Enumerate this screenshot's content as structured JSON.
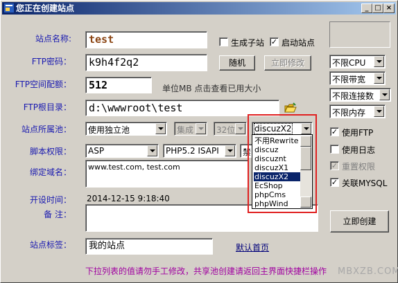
{
  "window": {
    "title": "您正在创建站点",
    "minimize": "_",
    "maximize": "□",
    "close": "×"
  },
  "labels": {
    "site_name": "站点名称:",
    "ftp_password": "FTP密码：",
    "ftp_quota": "FTP空间配额：",
    "ftp_root": "FTP根目录：",
    "site_pool": "站点所属池：",
    "script_perm": "脚本权限：",
    "bind_domain": "绑定域名：",
    "open_time": "开设时间：",
    "remark": "备 注：",
    "site_tag": "站点标签："
  },
  "fields": {
    "site_name": "test",
    "ftp_password": "k9h4f2q2",
    "ftp_quota": "512",
    "quota_hint": "单位MB 点击查看已用大小",
    "ftp_root": "d:\\wwwroot\\test",
    "domains": "www.test.com, test.com",
    "open_time": "2014-12-15 9:18:40",
    "remark": "",
    "site_tag": "我的站点"
  },
  "checkboxes": {
    "gen_subsite": {
      "label": "生成子站",
      "checked": false
    },
    "start_site": {
      "label": "启动站点",
      "checked": true
    },
    "use_ftp": {
      "label": "使用FTP",
      "checked": true
    },
    "use_log": {
      "label": "使用日志",
      "checked": false
    },
    "reset_perm": {
      "label": "重置权限",
      "checked": true
    },
    "link_mysql": {
      "label": "关联MYSQL",
      "checked": true
    }
  },
  "buttons": {
    "random": "随机",
    "apply_change": "立即修改",
    "create_now": "立即创建"
  },
  "combos": {
    "pool": "使用独立池",
    "integrated": "集成",
    "bit": "32位",
    "app": "discuzX2",
    "script": "ASP",
    "php": "PHP5.2 ISAPI",
    "ban": "禁",
    "cpu": "不限CPU",
    "bandwidth": "不限带宽",
    "connections": "不限连接数",
    "memory": "不限内存"
  },
  "dropdown_options": [
    "不用Rewrite",
    "discuz",
    "discuznt",
    "discuzX1",
    "discuzX2",
    "EcShop",
    "phpCms",
    "phpWind"
  ],
  "dropdown_selected": "discuzX2",
  "links": {
    "default_home": "默认首页"
  },
  "footer_note": "下拉列表的值请勿手工修改，共享池创建请返回主界面快捷栏操作",
  "watermark": "MBXZB.COM"
}
